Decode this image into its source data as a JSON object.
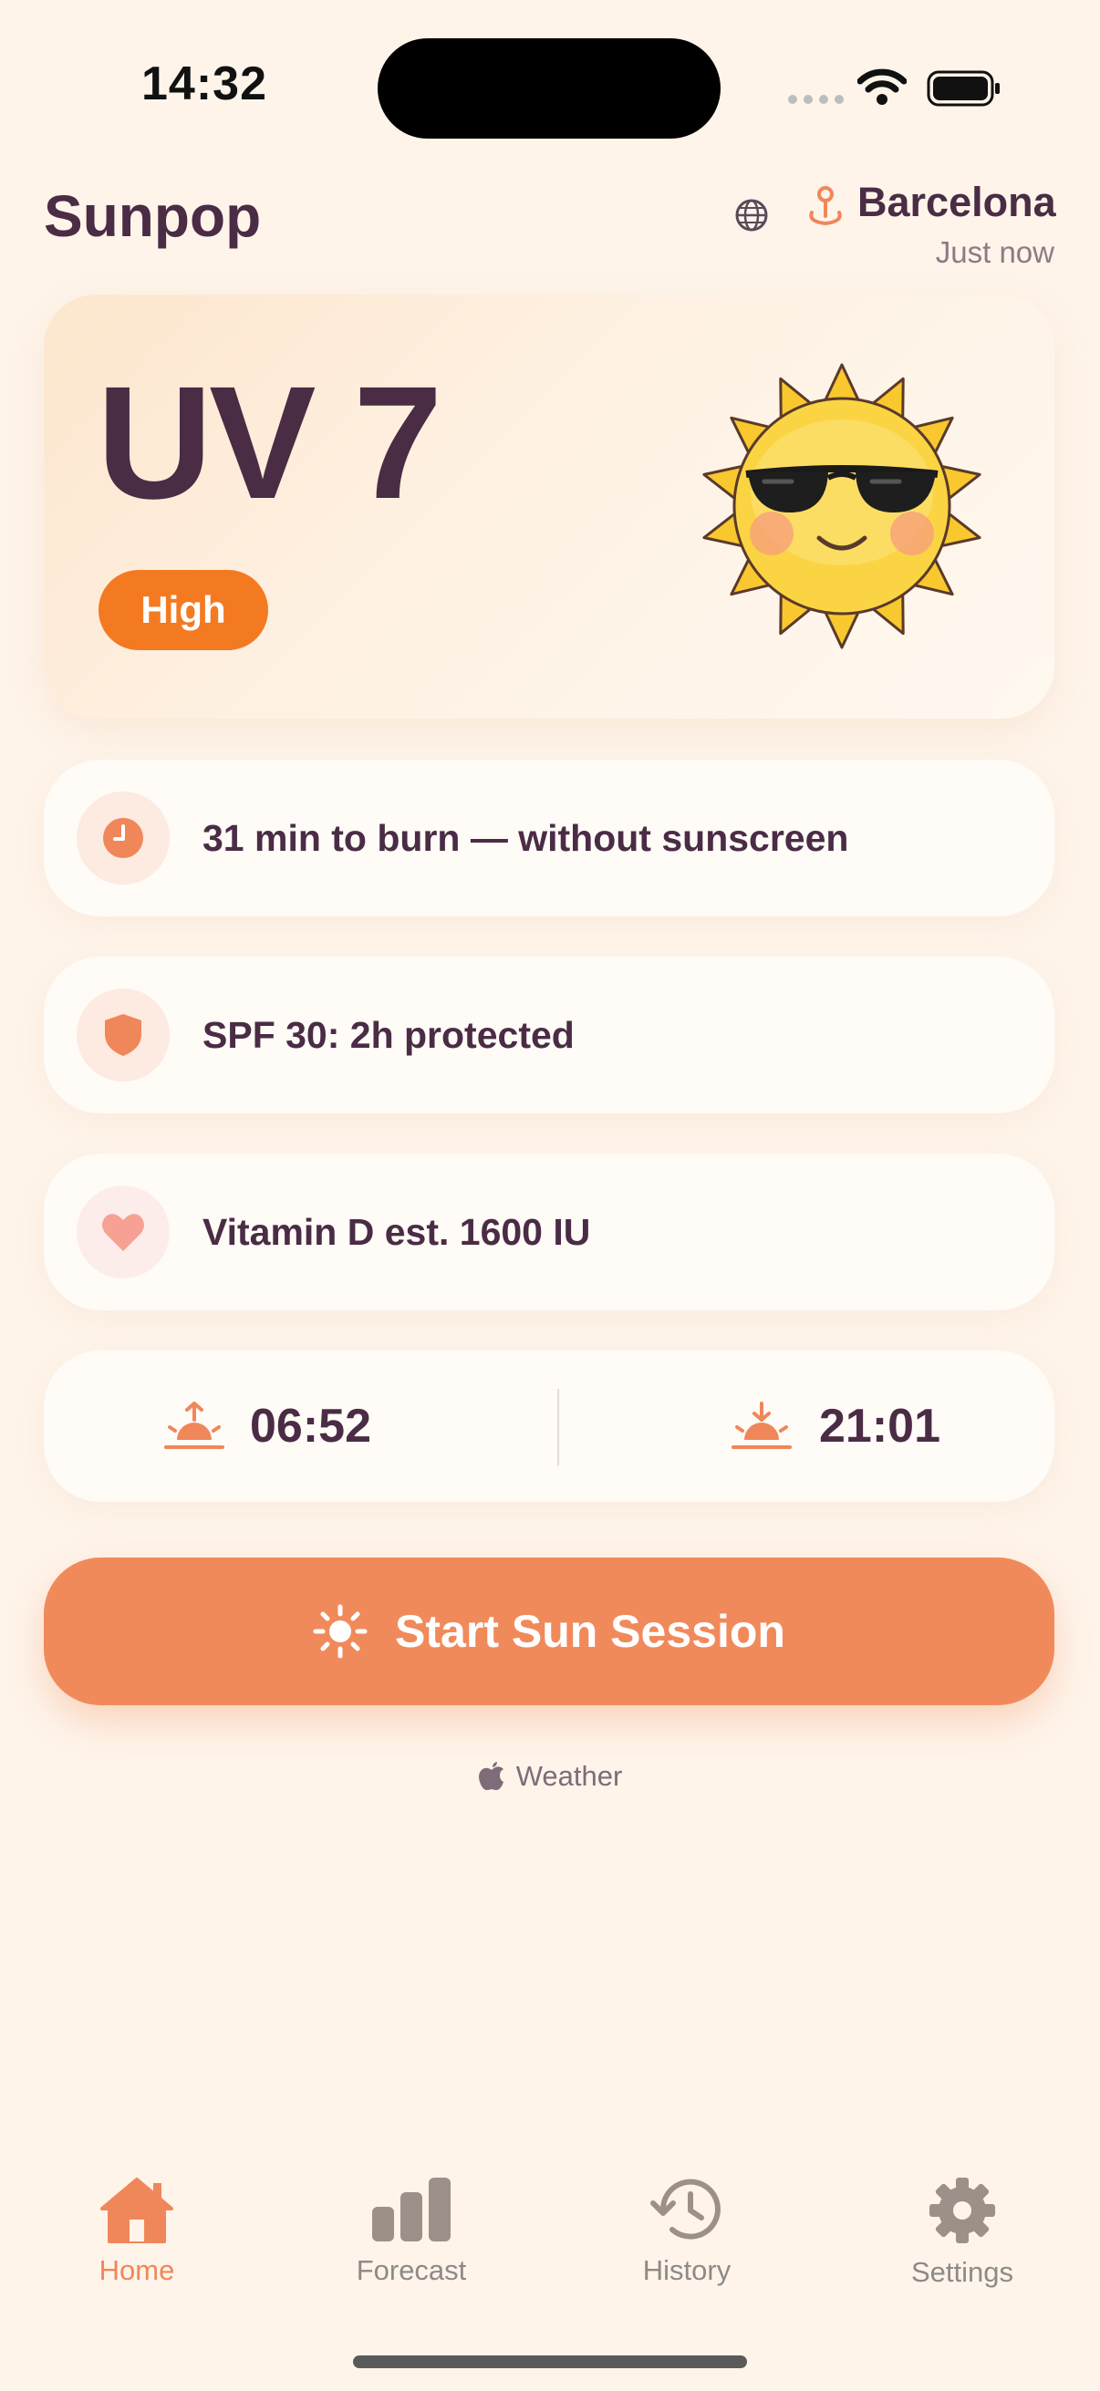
{
  "status_bar": {
    "time": "14:32"
  },
  "header": {
    "app_title": "Sunpop",
    "location": "Barcelona",
    "updated": "Just now"
  },
  "hero": {
    "uv_label": "UV 7",
    "risk_level": "High"
  },
  "cards": {
    "burn": {
      "icon": "clock-icon",
      "text": "31 min to burn — without sunscreen"
    },
    "spf": {
      "icon": "shield-icon",
      "text": "SPF 30: 2h protected"
    },
    "vitamin_d": {
      "icon": "heart-icon",
      "text": "Vitamin D est. 1600 IU"
    }
  },
  "sun_times": {
    "sunrise": "06:52",
    "sunset": "21:01"
  },
  "cta": {
    "label": "Start Sun Session",
    "icon": "sun-icon"
  },
  "attribution": {
    "label": "Weather",
    "icon": "apple-icon"
  },
  "tabs": [
    {
      "label": "Home",
      "icon": "house-icon",
      "active": true
    },
    {
      "label": "Forecast",
      "icon": "bar-chart-icon",
      "active": false
    },
    {
      "label": "History",
      "icon": "history-icon",
      "active": false
    },
    {
      "label": "Settings",
      "icon": "gear-icon",
      "active": false
    }
  ],
  "colors": {
    "background": "#FEF4EA",
    "text": "#4A2C45",
    "accent": "#F18A5B",
    "risk_high": "#F47A22",
    "tab_inactive": "#8E8A86"
  }
}
